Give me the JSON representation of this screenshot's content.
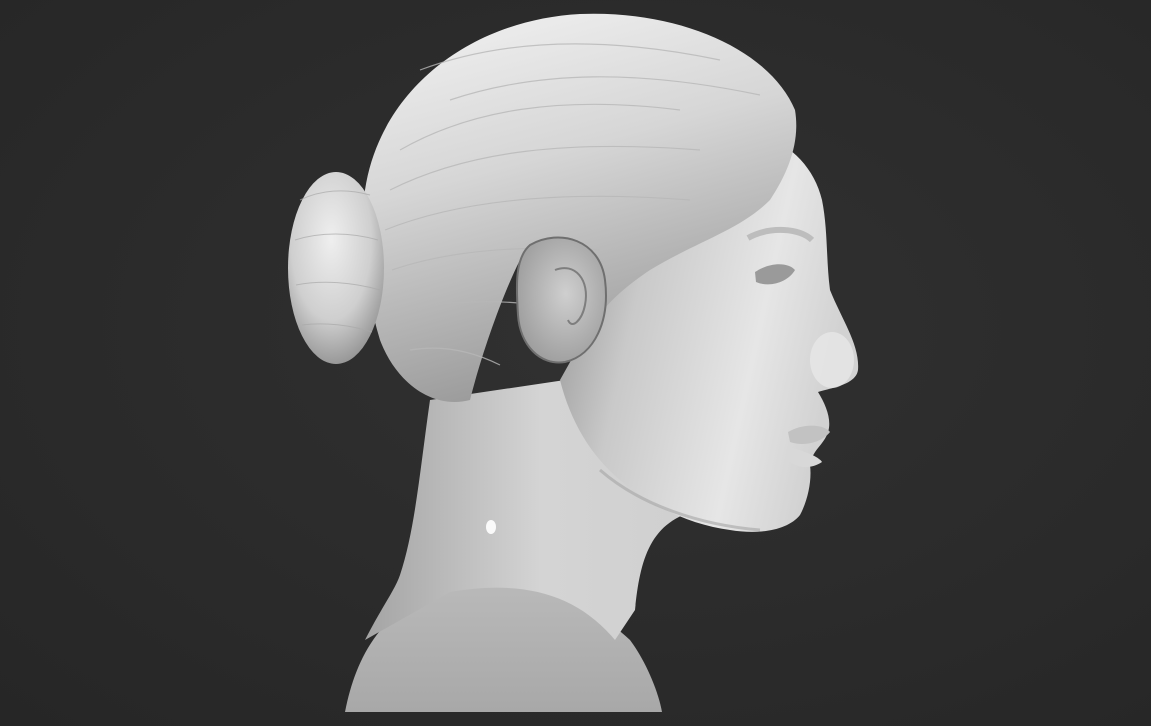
{
  "scene": {
    "subject": "sculpted-bust-profile",
    "background_color": "#2b2b2b",
    "clay_color": "#d9d9d9",
    "clay_shadow_color": "#7a7a7a",
    "clay_highlight_color": "#f2f2f2"
  }
}
